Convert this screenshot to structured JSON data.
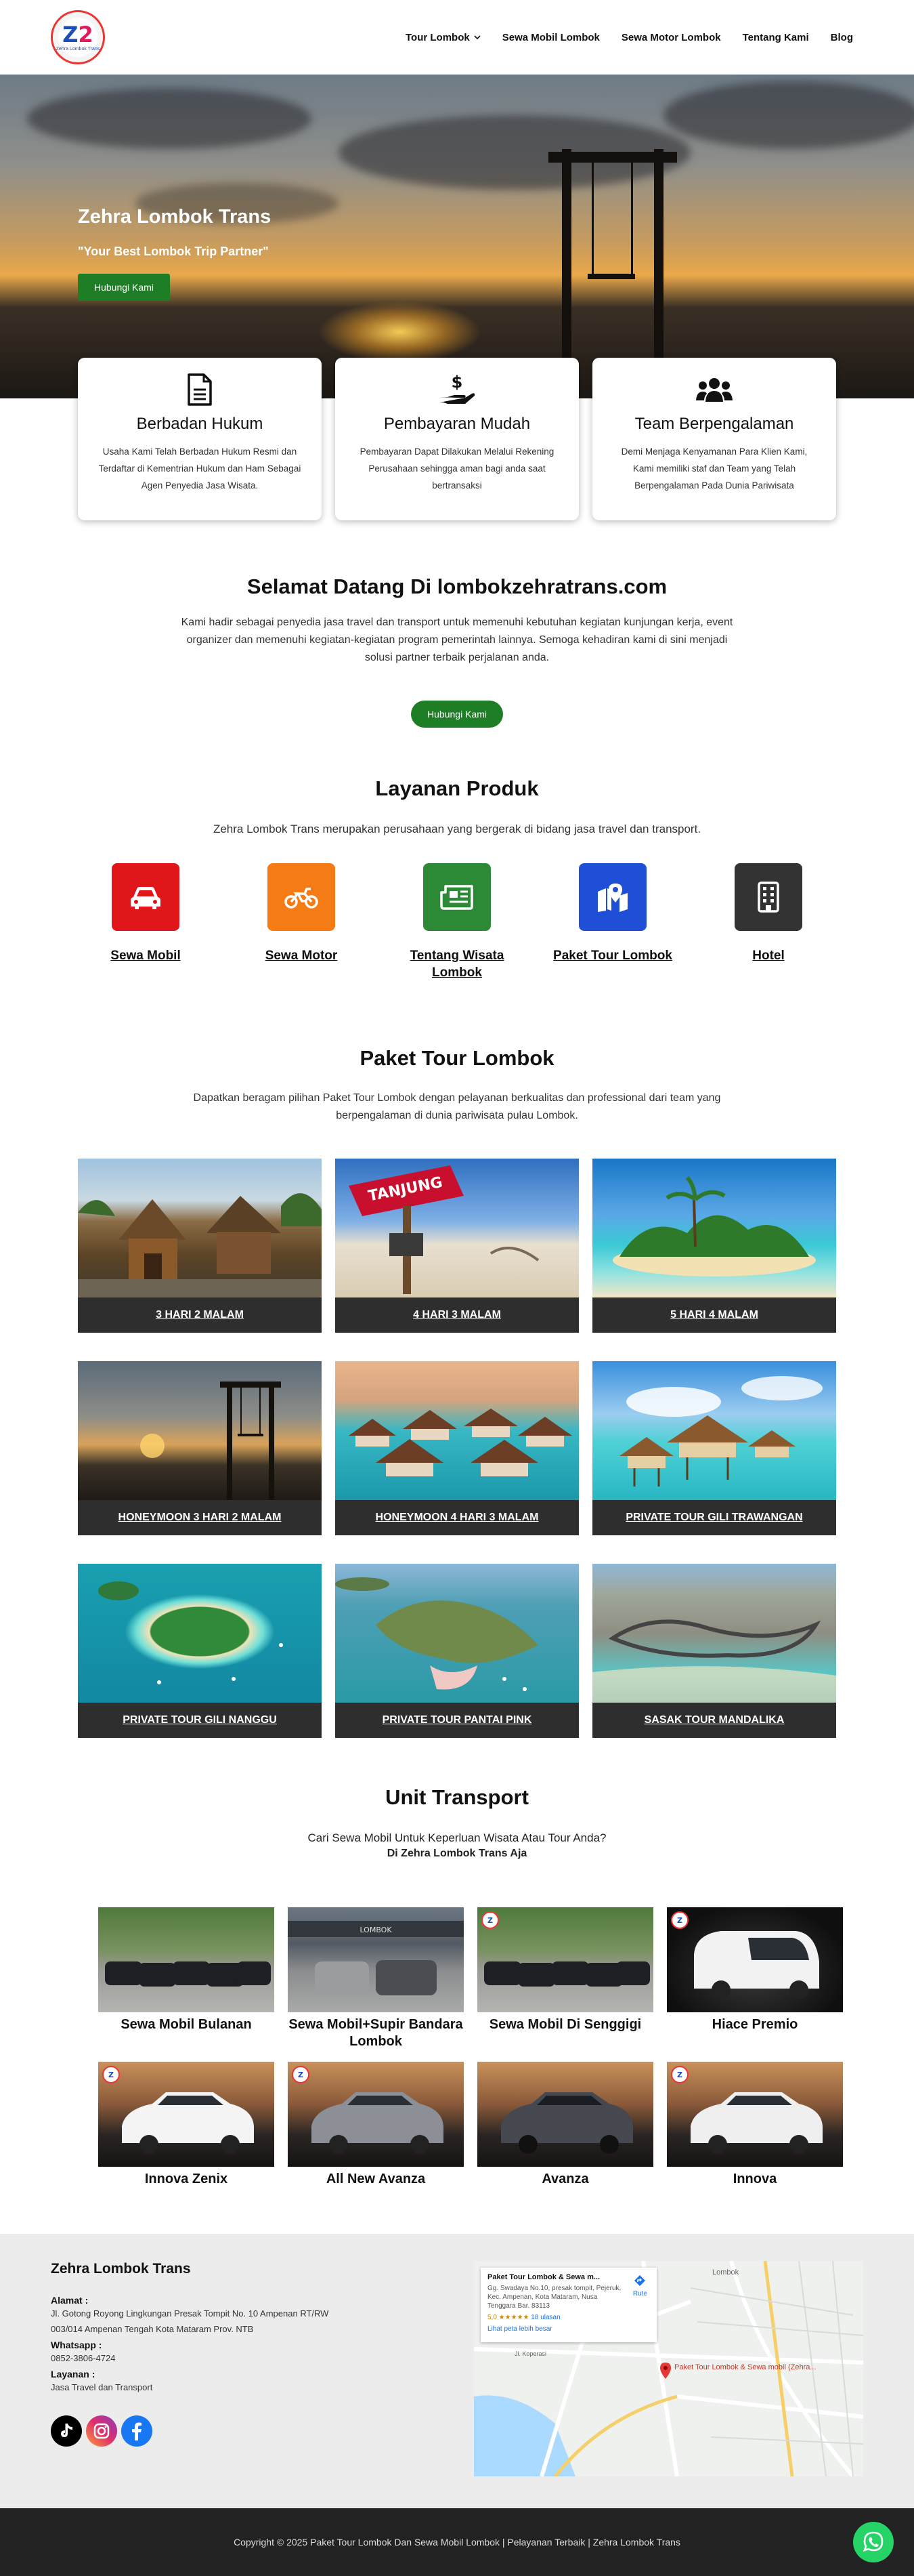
{
  "header": {
    "logo_text": "Zehra Lombok Trans",
    "nav": [
      {
        "label": "Tour Lombok",
        "has_dropdown": true
      },
      {
        "label": "Sewa Mobil Lombok"
      },
      {
        "label": "Sewa Motor Lombok"
      },
      {
        "label": "Tentang Kami"
      },
      {
        "label": "Blog"
      }
    ]
  },
  "hero": {
    "title": "Zehra Lombok Trans",
    "tagline": "\"Your Best Lombok Trip Partner\"",
    "button": "Hubungi Kami"
  },
  "features": [
    {
      "icon": "document-icon",
      "title": "Berbadan Hukum",
      "text": "Usaha Kami Telah Berbadan Hukum Resmi dan Terdaftar di Kementrian Hukum dan Ham Sebagai Agen Penyedia Jasa Wisata."
    },
    {
      "icon": "hand-dollar-icon",
      "title": "Pembayaran Mudah",
      "text": "Pembayaran Dapat Dilakukan Melalui Rekening Perusahaan sehingga aman bagi anda saat bertransaksi"
    },
    {
      "icon": "team-icon",
      "title": "Team Berpengalaman",
      "text": "Demi Menjaga Kenyamanan Para Klien Kami, Kami memiliki staf dan Team yang Telah Berpengalaman Pada Dunia Pariwisata"
    }
  ],
  "welcome": {
    "title": "Selamat Datang Di lombokzehratrans.com",
    "text": "Kami hadir sebagai penyedia jasa travel dan transport untuk memenuhi kebutuhan kegiatan kunjungan kerja, event organizer dan memenuhi kegiatan-kegiatan program pemerintah lainnya. Semoga kehadiran kami di sini menjadi solusi partner terbaik perjalanan anda.",
    "button": "Hubungi Kami"
  },
  "layanan": {
    "title": "Layanan Produk",
    "subtitle": "Zehra Lombok Trans merupakan perusahaan yang bergerak di bidang jasa travel dan transport.",
    "items": [
      {
        "label": "Sewa Mobil",
        "icon": "car-icon",
        "color": "#e0161b"
      },
      {
        "label": "Sewa Motor",
        "icon": "motorcycle-icon",
        "color": "#f57c14"
      },
      {
        "label": "Tentang Wisata Lombok",
        "icon": "newspaper-icon",
        "color": "#2c8a37"
      },
      {
        "label": "Paket Tour Lombok",
        "icon": "map-pin-icon",
        "color": "#1f4fd6"
      },
      {
        "label": "Hotel",
        "icon": "building-icon",
        "color": "#333333"
      }
    ]
  },
  "paket": {
    "title": "Paket Tour Lombok",
    "subtitle": "Dapatkan beragam pilihan Paket Tour Lombok dengan pelayanan berkualitas dan professional dari team yang berpengalaman di dunia pariwisata pulau Lombok.",
    "tours": [
      "3 HARI 2 MALAM",
      "4 HARI 3 MALAM",
      "5 HARI 4 MALAM",
      "HONEYMOON 3 HARI 2 MALAM",
      "HONEYMOON 4 HARI 3 MALAM",
      "PRIVATE TOUR GILI TRAWANGAN",
      "PRIVATE TOUR GILI NANGGU",
      "PRIVATE TOUR PANTAI PINK",
      "SASAK TOUR MANDALIKA"
    ]
  },
  "unit": {
    "title": "Unit Transport",
    "subtitle1": "Cari Sewa Mobil Untuk Keperluan Wisata Atau Tour Anda?",
    "subtitle2": "Di Zehra Lombok Trans Aja",
    "cars": [
      "Sewa Mobil Bulanan",
      "Sewa Mobil+Supir Bandara Lombok",
      "Sewa Mobil Di Senggigi",
      "Hiace Premio",
      "Innova Zenix",
      "All New Avanza",
      "Avanza",
      "Innova"
    ]
  },
  "footer": {
    "title": "Zehra Lombok Trans",
    "alamat_label": "Alamat :",
    "alamat": "Jl. Gotong Royong Lingkungan Presak Tompit No. 10 Ampenan RT/RW 003/014 Ampenan Tengah Kota Mataram Prov. NTB",
    "whatsapp_label": "Whatsapp :",
    "whatsapp": "0852-3806-4724",
    "layanan_label": "Layanan :",
    "layanan": "Jasa Travel dan Transport",
    "map": {
      "title": "Paket Tour Lombok & Sewa m...",
      "address": "Gg. Swadaya No.10, presak tompit, Pejeruk, Kec. Ampenan, Kota Mataram, Nusa Tenggara Bar. 83113",
      "rating": "5,0",
      "reviews": "18 ulasan",
      "link": "Lihat peta lebih besar",
      "route": "Rute",
      "pin_label": "Paket Tour Lombok & Sewa mobil (Zehra..."
    }
  },
  "copyright": "Copyright © 2025 Paket Tour Lombok Dan Sewa Mobil Lombok | Pelayanan Terbaik | Zehra Lombok Trans"
}
